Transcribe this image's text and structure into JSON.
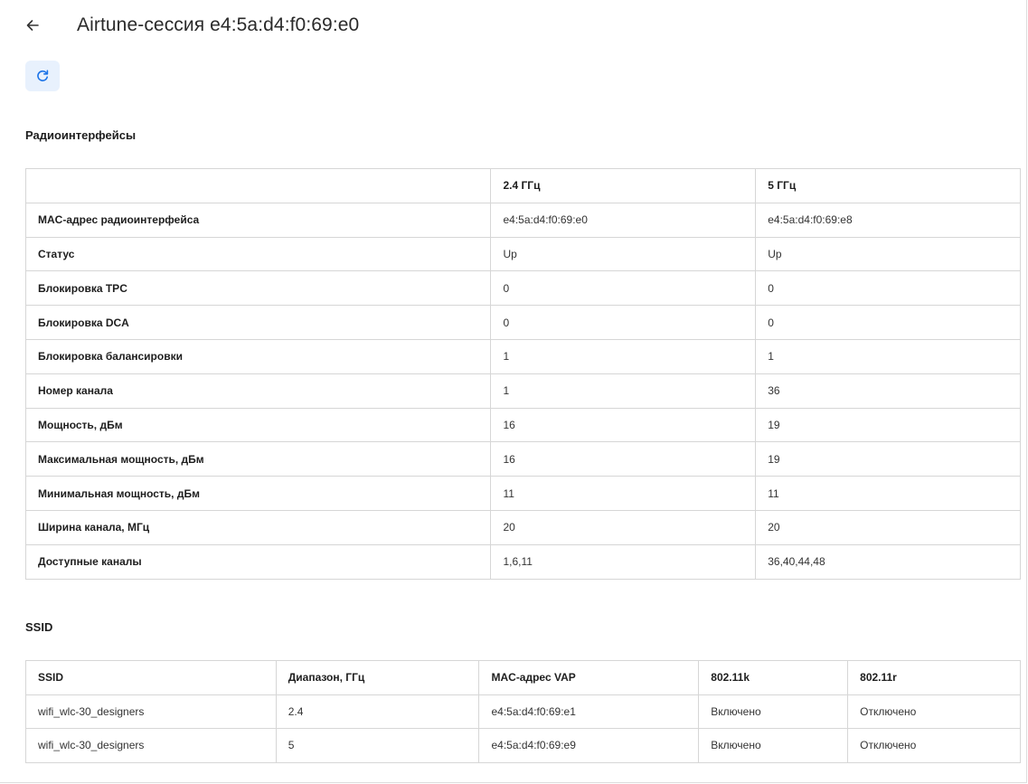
{
  "header": {
    "title": "Airtune-сессия e4:5a:d4:f0:69:e0",
    "back_icon": "arrow-left-icon",
    "refresh_icon": "refresh-icon"
  },
  "colors": {
    "accent": "#1a73e8",
    "refresh_bg": "#e8f1fd",
    "border": "#d6d6d6"
  },
  "radio": {
    "section_title": "Радиоинтерфейсы",
    "columns": [
      "",
      "2.4 ГГц",
      "5 ГГц"
    ],
    "rows": [
      {
        "label": "MAC-адрес радиоинтерфейса",
        "v24": "e4:5a:d4:f0:69:e0",
        "v5": "e4:5a:d4:f0:69:e8"
      },
      {
        "label": "Статус",
        "v24": "Up",
        "v5": "Up"
      },
      {
        "label": "Блокировка TPC",
        "v24": "0",
        "v5": "0"
      },
      {
        "label": "Блокировка DCA",
        "v24": "0",
        "v5": "0"
      },
      {
        "label": "Блокировка балансировки",
        "v24": "1",
        "v5": "1"
      },
      {
        "label": "Номер канала",
        "v24": "1",
        "v5": "36"
      },
      {
        "label": "Мощность, дБм",
        "v24": "16",
        "v5": "19"
      },
      {
        "label": "Максимальная мощность, дБм",
        "v24": "16",
        "v5": "19"
      },
      {
        "label": "Минимальная мощность, дБм",
        "v24": "11",
        "v5": "11"
      },
      {
        "label": "Ширина канала, МГц",
        "v24": "20",
        "v5": "20"
      },
      {
        "label": "Доступные каналы",
        "v24": "1,6,11",
        "v5": "36,40,44,48"
      }
    ]
  },
  "ssid": {
    "section_title": "SSID",
    "columns": [
      "SSID",
      "Диапазон, ГГц",
      "MAC-адрес VAP",
      "802.11k",
      "802.11r"
    ],
    "rows": [
      {
        "ssid": "wifi_wlc-30_designers",
        "band": "2.4",
        "mac": "e4:5a:d4:f0:69:e1",
        "k": "Включено",
        "r": "Отключено"
      },
      {
        "ssid": "wifi_wlc-30_designers",
        "band": "5",
        "mac": "e4:5a:d4:f0:69:e9",
        "k": "Включено",
        "r": "Отключено"
      }
    ]
  }
}
